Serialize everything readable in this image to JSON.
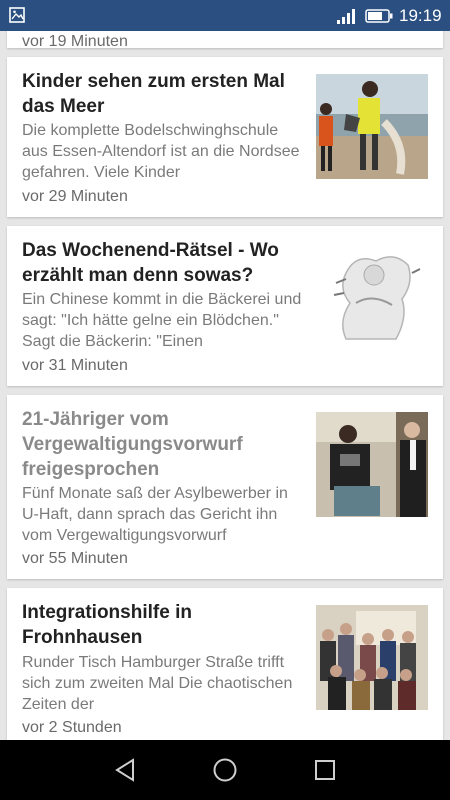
{
  "status_bar": {
    "time": "19:19"
  },
  "articles": [
    {
      "time": "vor 19 Minuten"
    },
    {
      "title": "Kinder sehen zum ersten Mal das Meer",
      "snippet": "Die komplette Bodelschwinghschule aus Essen-Altendorf ist an die Nordsee gefahren. Viele Kinder",
      "time": "vor 29 Minuten"
    },
    {
      "title": "Das Wochenend-Rätsel - Wo erzählt man denn sowas?",
      "snippet": "Ein Chinese kommt in die Bäckerei und sagt: \"Ich hätte gelne ein Blödchen.\" Sagt die Bäckerin: \"Einen",
      "time": "vor 31 Minuten"
    },
    {
      "title": "21-Jähriger vom Vergewaltigungsvorwurf freigesprochen",
      "snippet": "Fünf Monate saß der Asylbewerber in U-Haft, dann sprach das Gericht ihn vom Vergewaltigungsvorwurf",
      "time": "vor 55 Minuten"
    },
    {
      "title": "Integrationshilfe in Frohnhausen",
      "snippet": "Runder Tisch Hamburger Straße trifft sich zum zweiten Mal Die chaotischen Zeiten der",
      "time": "vor 2 Stunden"
    }
  ]
}
